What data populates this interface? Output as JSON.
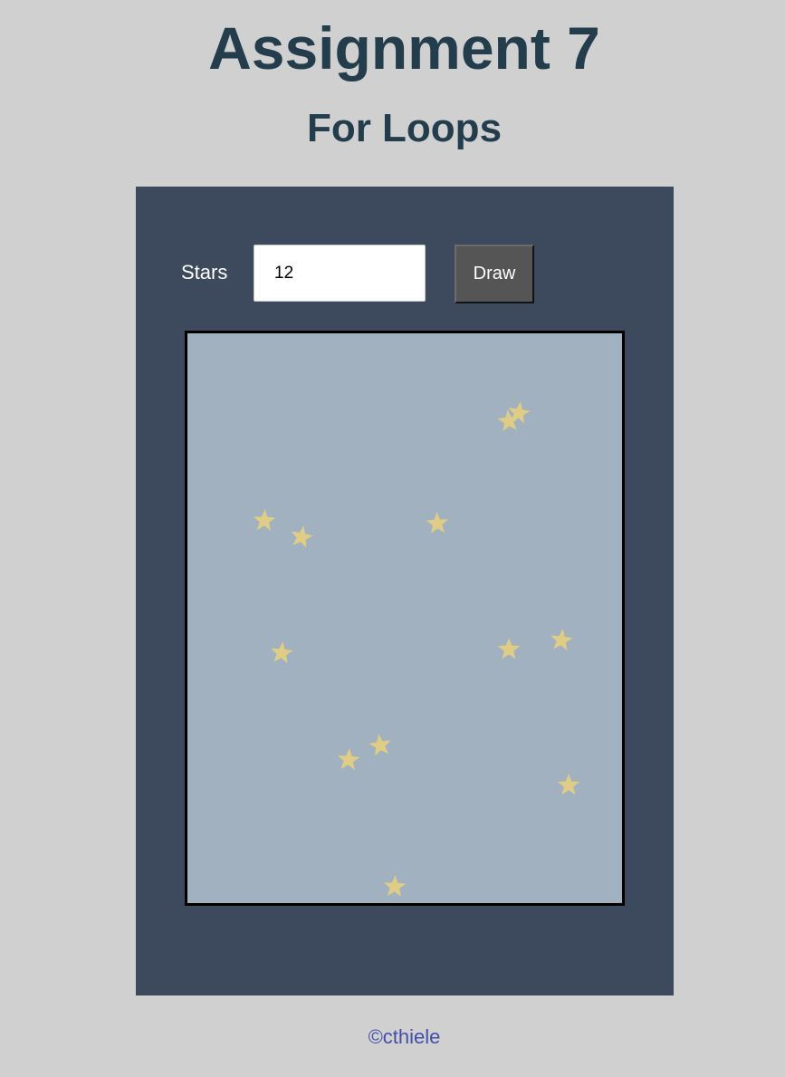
{
  "header": {
    "title": "Assignment 7",
    "subtitle": "For Loops"
  },
  "controls": {
    "stars_label": "Stars",
    "stars_value": "12",
    "draw_label": "Draw"
  },
  "canvas": {
    "background_color": "#a2b1c0",
    "star_color": "#e0cd85",
    "star_count": 12,
    "star_icon": "star-icon"
  },
  "footer": {
    "copyright": "©cthiele"
  },
  "colors": {
    "page_background": "#d0d0d0",
    "heading": "#233d4d",
    "panel": "#3d4a5d",
    "button": "#555555",
    "footer_text": "#4450a8"
  }
}
